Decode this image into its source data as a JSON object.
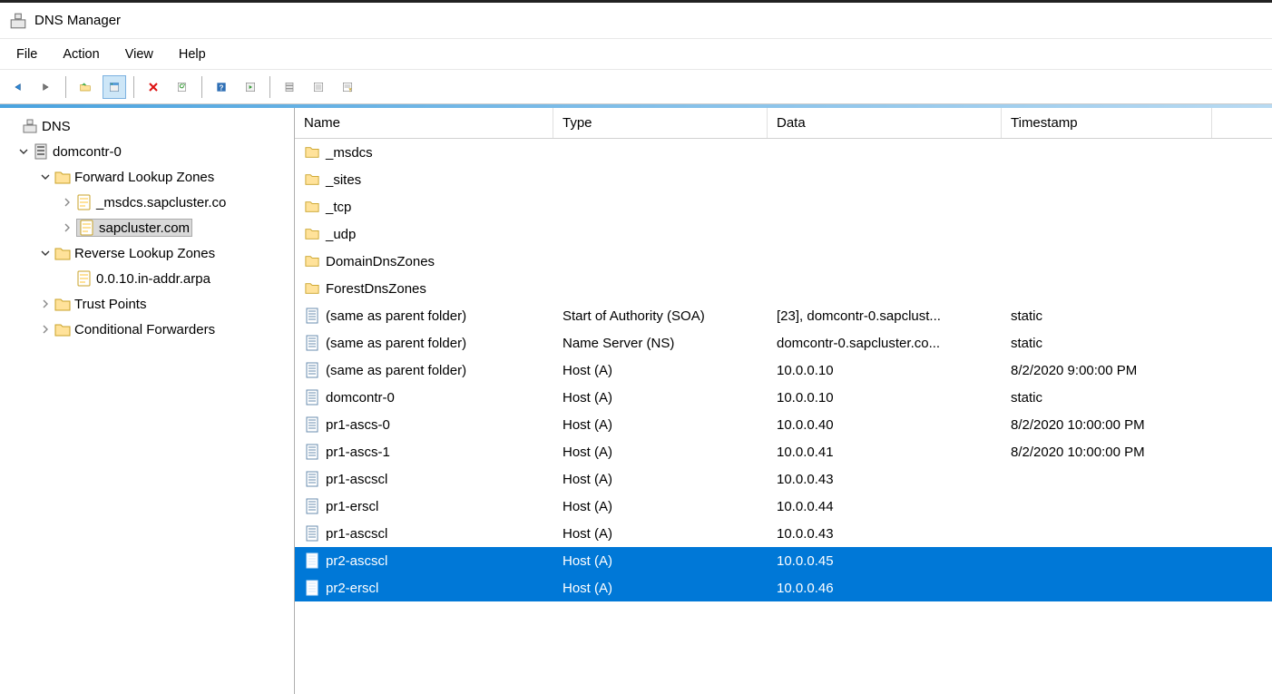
{
  "app": {
    "title": "DNS Manager"
  },
  "menu": {
    "file": "File",
    "action": "Action",
    "view": "View",
    "help": "Help"
  },
  "tree": {
    "root": "DNS",
    "server": "domcontr-0",
    "flz": "Forward Lookup Zones",
    "flz_items": [
      "_msdcs.sapcluster.co",
      "sapcluster.com"
    ],
    "rlz": "Reverse Lookup Zones",
    "rlz_items": [
      "0.0.10.in-addr.arpa"
    ],
    "trust": "Trust Points",
    "cond": "Conditional Forwarders"
  },
  "columns": {
    "name": "Name",
    "type": "Type",
    "data": "Data",
    "ts": "Timestamp"
  },
  "records": [
    {
      "icon": "folder",
      "name": "_msdcs",
      "type": "",
      "data": "",
      "ts": "",
      "sel": false
    },
    {
      "icon": "folder",
      "name": "_sites",
      "type": "",
      "data": "",
      "ts": "",
      "sel": false
    },
    {
      "icon": "folder",
      "name": "_tcp",
      "type": "",
      "data": "",
      "ts": "",
      "sel": false
    },
    {
      "icon": "folder",
      "name": "_udp",
      "type": "",
      "data": "",
      "ts": "",
      "sel": false
    },
    {
      "icon": "folder",
      "name": "DomainDnsZones",
      "type": "",
      "data": "",
      "ts": "",
      "sel": false
    },
    {
      "icon": "folder",
      "name": "ForestDnsZones",
      "type": "",
      "data": "",
      "ts": "",
      "sel": false
    },
    {
      "icon": "rec",
      "name": "(same as parent folder)",
      "type": "Start of Authority (SOA)",
      "data": "[23], domcontr-0.sapclust...",
      "ts": "static",
      "sel": false
    },
    {
      "icon": "rec",
      "name": "(same as parent folder)",
      "type": "Name Server (NS)",
      "data": "domcontr-0.sapcluster.co...",
      "ts": "static",
      "sel": false
    },
    {
      "icon": "rec",
      "name": "(same as parent folder)",
      "type": "Host (A)",
      "data": "10.0.0.10",
      "ts": "8/2/2020 9:00:00 PM",
      "sel": false
    },
    {
      "icon": "rec",
      "name": "domcontr-0",
      "type": "Host (A)",
      "data": "10.0.0.10",
      "ts": "static",
      "sel": false
    },
    {
      "icon": "rec",
      "name": "pr1-ascs-0",
      "type": "Host (A)",
      "data": "10.0.0.40",
      "ts": "8/2/2020 10:00:00 PM",
      "sel": false
    },
    {
      "icon": "rec",
      "name": "pr1-ascs-1",
      "type": "Host (A)",
      "data": "10.0.0.41",
      "ts": "8/2/2020 10:00:00 PM",
      "sel": false
    },
    {
      "icon": "rec",
      "name": "pr1-ascscl",
      "type": "Host (A)",
      "data": "10.0.0.43",
      "ts": "",
      "sel": false
    },
    {
      "icon": "rec",
      "name": "pr1-erscl",
      "type": "Host (A)",
      "data": "10.0.0.44",
      "ts": "",
      "sel": false
    },
    {
      "icon": "rec",
      "name": "pr1-ascscl",
      "type": "Host (A)",
      "data": "10.0.0.43",
      "ts": "",
      "sel": false
    },
    {
      "icon": "rec",
      "name": "pr2-ascscl",
      "type": "Host (A)",
      "data": "10.0.0.45",
      "ts": "",
      "sel": true
    },
    {
      "icon": "rec",
      "name": "pr2-erscl",
      "type": "Host (A)",
      "data": "10.0.0.46",
      "ts": "",
      "sel": true
    }
  ]
}
